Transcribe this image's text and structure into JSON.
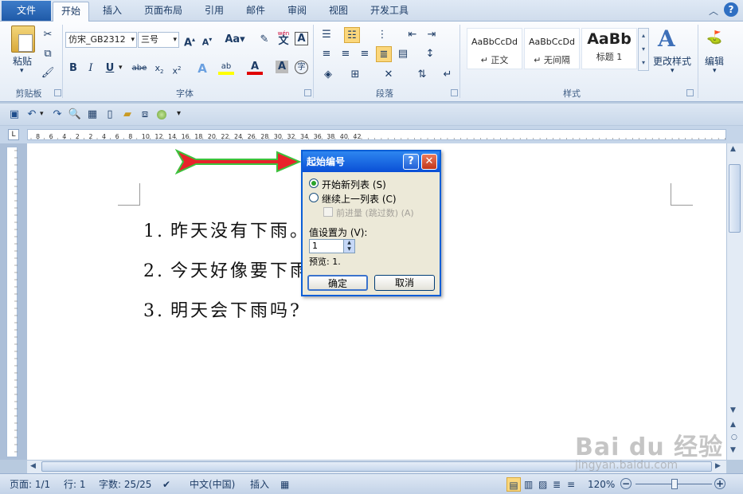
{
  "tabs": {
    "file": "文件",
    "items": [
      "开始",
      "插入",
      "页面布局",
      "引用",
      "邮件",
      "审阅",
      "视图",
      "开发工具"
    ],
    "active_index": 0
  },
  "ribbon": {
    "clipboard": {
      "label": "剪贴板",
      "paste": "粘贴"
    },
    "font": {
      "label": "字体",
      "font_name": "仿宋_GB2312",
      "font_size": "三号",
      "wen_label": "wén"
    },
    "paragraph": {
      "label": "段落"
    },
    "styles": {
      "label": "样式",
      "items": [
        {
          "preview": "AaBbCcDd",
          "name": "↵ 正文"
        },
        {
          "preview": "AaBbCcDd",
          "name": "↵ 无间隔"
        },
        {
          "preview": "AaBb",
          "name": "标题 1"
        }
      ],
      "change_styles": "更改样式"
    },
    "editing": {
      "label": "编辑"
    }
  },
  "ruler": {
    "marks": [
      "8",
      "6",
      "4",
      "2",
      "2",
      "4",
      "6",
      "8",
      "10",
      "12",
      "14",
      "16",
      "18",
      "20",
      "22",
      "24",
      "26",
      "28",
      "30",
      "32",
      "34",
      "36",
      "38",
      "40",
      "42"
    ]
  },
  "document": {
    "lines": [
      {
        "num": "1.",
        "text": "昨天没有下雨。"
      },
      {
        "num": "2.",
        "text": "今天好像要下雨"
      },
      {
        "num": "3.",
        "text": "明天会下雨吗?"
      }
    ]
  },
  "dialog": {
    "title": "起始编号",
    "help": "?",
    "close": "✕",
    "opt_new": "开始新列表 (S)",
    "opt_continue": "继续上一列表 (C)",
    "opt_advance": "前进量 (跳过数) (A)",
    "value_label": "值设置为 (V):",
    "value": "1",
    "preview": "预览: 1.",
    "ok": "确定",
    "cancel": "取消"
  },
  "status": {
    "page": "页面: 1/1",
    "line": "行: 1",
    "words": "字数: 25/25",
    "language": "中文(中国)",
    "mode": "插入",
    "zoom": "120%"
  },
  "watermark": {
    "brand": "Bai du 经验",
    "url": "jingyan.baidu.com"
  },
  "colors": {
    "accent": "#1f5aa8",
    "arrow": "#e8232a",
    "dialog_title": "#0a4fd6"
  }
}
